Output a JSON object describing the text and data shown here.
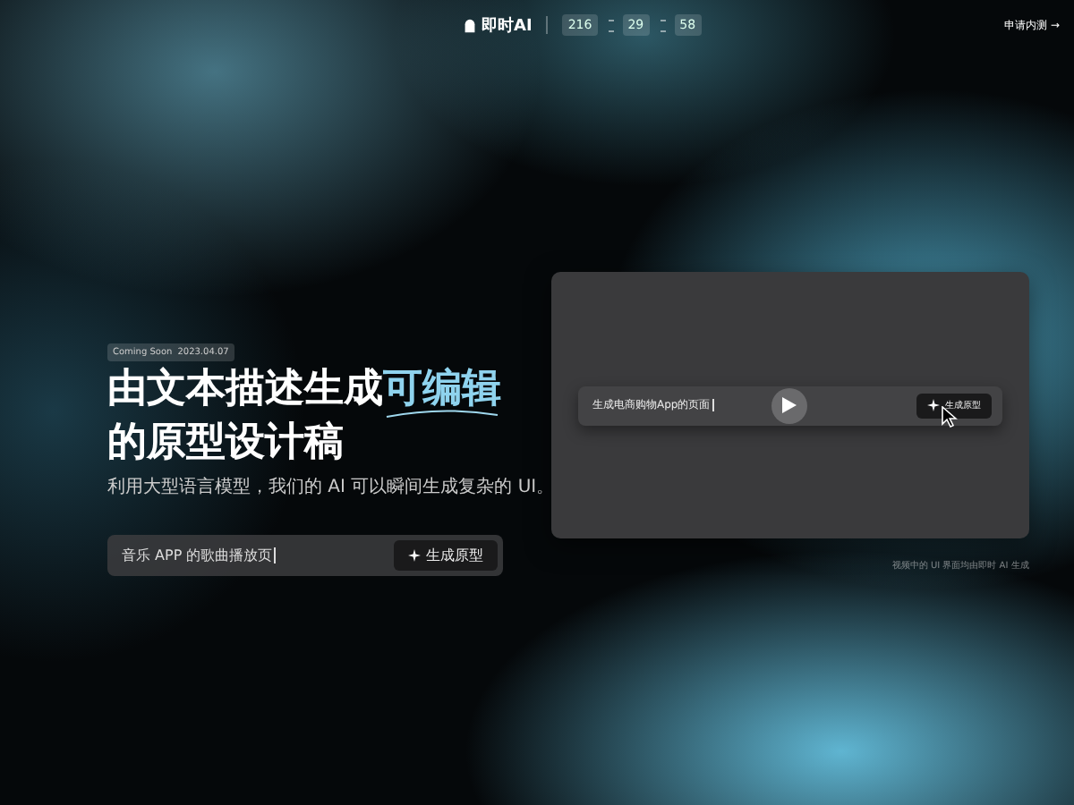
{
  "header": {
    "brand": "即时AI",
    "countdown": [
      "216",
      "29",
      "58"
    ],
    "apply_link": "申请内测 →"
  },
  "hero": {
    "badge": {
      "label": "Coming Soon",
      "date": "2023.04.07"
    },
    "title": {
      "line_1": "由文本描述生成",
      "highlight": "可编辑",
      "line_2": "的原型设计稿"
    },
    "subtitle": "利用大型语言模型，我们的 AI 可以瞬间生成复杂的 UI。",
    "prompt": {
      "value": "音乐 APP 的歌曲播放页",
      "button": "生成原型"
    }
  },
  "demo_video": {
    "prompt_value": "生成电商购物App的页面",
    "button": "生成原型",
    "caption": "视频中的 UI 界面均由即时 AI 生成"
  }
}
